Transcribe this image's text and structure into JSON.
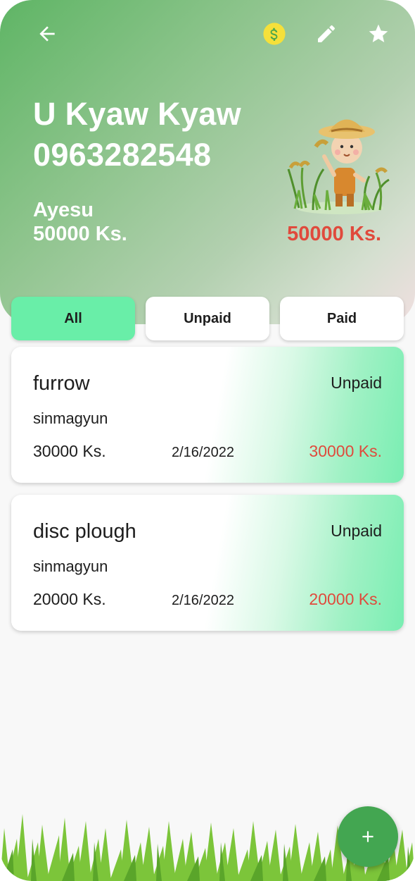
{
  "header": {
    "name": "U Kyaw Kyaw",
    "phone": "0963282548",
    "village": "Ayesu",
    "land_amount": "50000 Ks.",
    "total_amount": "50000 Ks."
  },
  "toolbar": {
    "back_icon": "arrow-left-icon",
    "pay_icon": "dollar-coin-icon",
    "edit_icon": "pencil-icon",
    "favorite_icon": "star-icon"
  },
  "filters": [
    {
      "label": "All",
      "active": true
    },
    {
      "label": "Unpaid",
      "active": false
    },
    {
      "label": "Paid",
      "active": false
    }
  ],
  "records": [
    {
      "title": "furrow",
      "status": "Unpaid",
      "person": "sinmagyun",
      "price": "30000 Ks.",
      "date": "2/16/2022",
      "due": "30000 Ks."
    },
    {
      "title": "disc plough",
      "status": "Unpaid",
      "person": "sinmagyun",
      "price": "20000 Ks.",
      "date": "2/16/2022",
      "due": "20000 Ks."
    }
  ],
  "colors": {
    "accent_green": "#43a651",
    "active_filter": "#69eea8",
    "amount_red": "#e04a3c",
    "coin_yellow": "#f5e03a"
  }
}
